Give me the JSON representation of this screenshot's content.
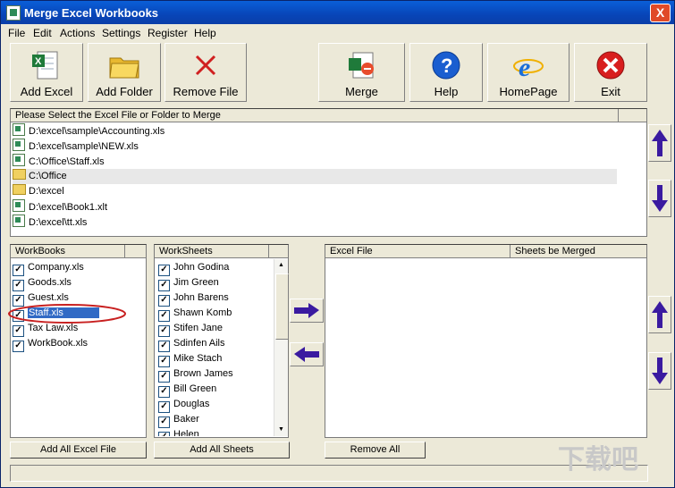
{
  "window": {
    "title": "Merge Excel Workbooks",
    "close_label": "X"
  },
  "menu": [
    "File",
    "Edit",
    "Actions",
    "Settings",
    "Register",
    "Help"
  ],
  "toolbar": {
    "add_excel": "Add Excel",
    "add_folder": "Add Folder",
    "remove_file": "Remove File",
    "merge": "Merge",
    "help": "Help",
    "homepage": "HomePage",
    "exit": "Exit"
  },
  "file_list": {
    "header": "Please Select the Excel File or Folder to Merge",
    "items": [
      {
        "type": "file",
        "path": "D:\\excel\\sample\\Accounting.xls"
      },
      {
        "type": "file",
        "path": "D:\\excel\\sample\\NEW.xls"
      },
      {
        "type": "file",
        "path": "C:\\Office\\Staff.xls"
      },
      {
        "type": "folder",
        "path": "C:\\Office"
      },
      {
        "type": "folder",
        "path": "D:\\excel"
      },
      {
        "type": "file",
        "path": "D:\\excel\\Book1.xlt"
      },
      {
        "type": "file",
        "path": "D:\\excel\\tt.xls"
      }
    ]
  },
  "workbooks": {
    "header": "WorkBooks",
    "items": [
      "Company.xls",
      "Goods.xls",
      "Guest.xls",
      "Staff.xls",
      "Tax Law.xls",
      "WorkBook.xls"
    ],
    "selected": "Staff.xls"
  },
  "worksheets": {
    "header": "WorkSheets",
    "items": [
      "John Godina",
      "Jim Green",
      "John Barens",
      "Shawn Komb",
      "Stifen Jane",
      "Sdinfen Ails",
      "Mike Stach",
      "Brown James",
      "Bill Green",
      "Douglas",
      "Baker",
      "Helen"
    ]
  },
  "merge_table": {
    "col_excel_file": "Excel File",
    "col_sheets": "Sheets be Merged"
  },
  "bottom_buttons": {
    "add_all_excel": "Add All Excel File",
    "add_all_sheets": "Add All Sheets",
    "remove_all": "Remove All"
  },
  "checkmark": "✓",
  "watermark": "下载吧",
  "colors": {
    "accent": "#0a246a",
    "arrow": "#3a1aa0",
    "selection": "#316ac5"
  }
}
